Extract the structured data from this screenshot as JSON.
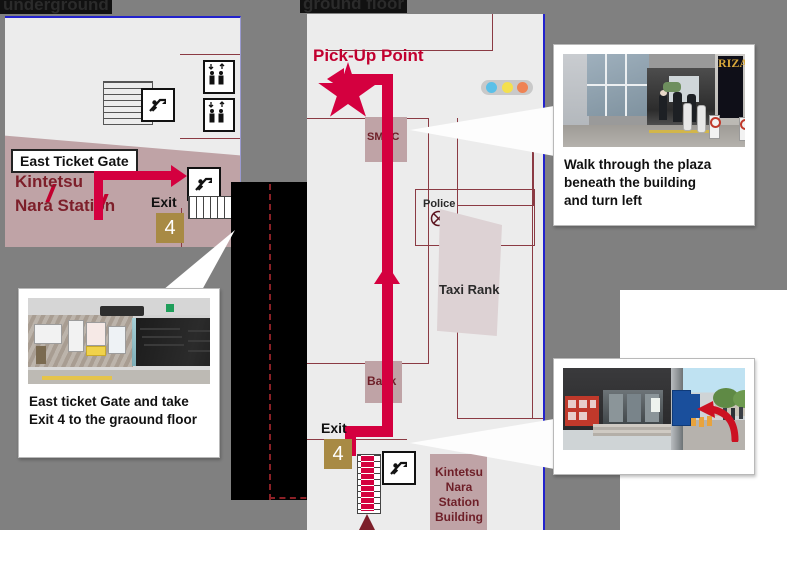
{
  "page": {
    "kind": "station-walking-directions-map",
    "accent_red": "#d4003f",
    "map_line_color": "#8b3a43",
    "building_fill": "#bfa3a6",
    "exit_badge_color": "#a88a44",
    "map_bg": "#ececec",
    "backdrop_gray": "#808080"
  },
  "headers": {
    "underground": "underground",
    "ground_floor": "ground floor"
  },
  "underground_map": {
    "station_name": "Kintetsu\nNara Station",
    "station_name_line1": "Kintetsu",
    "station_name_line2": "Nara Station",
    "ticket_gate_label": "East Ticket Gate",
    "exit_label": "Exit",
    "exit_number": "4",
    "icons": {
      "escalator_top": "escalator-icon",
      "escalator_exit": "escalator-icon",
      "elevator_upper": "elevator-icon",
      "elevator_lower": "elevator-icon",
      "stairs": "stairs-icon",
      "ticket_gates": "ticket-gate-icon"
    }
  },
  "ground_map": {
    "pickup_label": "Pick-Up Point",
    "smbc_label": "SMBC",
    "bank_label": "Bank",
    "police_label": "Police",
    "taxi_rank_label": "Taxi Rank",
    "exit_label": "Exit",
    "exit_number": "4",
    "station_building_line1": "Kintetsu",
    "station_building_line2": "Nara Station",
    "station_building_line3": "Building",
    "traffic_light": {
      "name": "traffic-light-icon",
      "dot_1_color": "#5bc0e8",
      "dot_2_color": "#f4e04d",
      "dot_3_color": "#ef8354"
    },
    "icons": {
      "police_box": "police-cross-icon",
      "escalator": "escalator-icon",
      "stairs": "stairs-icon",
      "star": "star-marker-icon"
    }
  },
  "callouts": [
    {
      "id": "bottom-left",
      "photo_name": "station-concourse-escalator-photo",
      "caption_line1": "East ticket Gate and take",
      "caption_line2": "Exit 4 to the graound floor"
    },
    {
      "id": "top-right",
      "photo_name": "plaza-beneath-building-photo",
      "photo_sign_text": "RIZAP",
      "caption_line1": "Walk through the plaza",
      "caption_line2": "beneath the building",
      "caption_line3": "and turn left"
    },
    {
      "id": "bottom-right",
      "photo_name": "street-corner-blue-pole-photo",
      "caption_line1": ""
    }
  ]
}
